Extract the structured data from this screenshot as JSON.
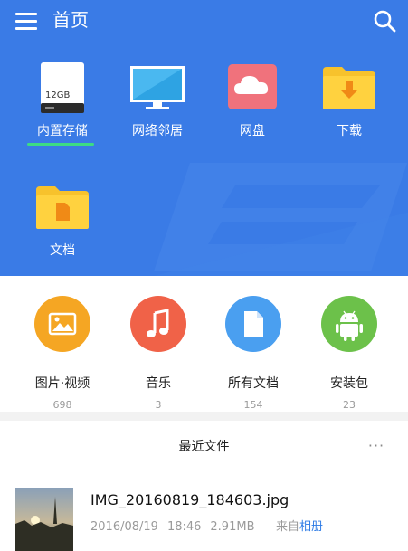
{
  "appbar": {
    "title": "首页",
    "menu_icon": "hamburger-menu-icon",
    "search_icon": "search-icon"
  },
  "storage_tiles": [
    {
      "label": "内置存储",
      "icon": "storage-12gb-icon",
      "badge": "12GB",
      "selected": true
    },
    {
      "label": "网络邻居",
      "icon": "monitor-icon"
    },
    {
      "label": "网盘",
      "icon": "cloud-icon"
    },
    {
      "label": "下载",
      "icon": "download-folder-icon"
    },
    {
      "label": "文档",
      "icon": "document-folder-icon"
    }
  ],
  "categories": [
    {
      "label": "图片·视频",
      "count": "698",
      "icon": "image-icon",
      "color": "#f5a623"
    },
    {
      "label": "音乐",
      "count": "3",
      "icon": "music-note-icon",
      "color": "#f06248"
    },
    {
      "label": "所有文档",
      "count": "154",
      "icon": "document-icon",
      "color": "#4a9ff0"
    },
    {
      "label": "安装包",
      "count": "23",
      "icon": "android-icon",
      "color": "#6cc14a"
    }
  ],
  "recent": {
    "title": "最近文件",
    "more_icon": "more-dots-icon",
    "files": [
      {
        "name": "IMG_20160819_184603.jpg",
        "date": "2016/08/19",
        "time": "18:46",
        "size": "2.91MB",
        "source_prefix": "来自",
        "source": "相册"
      }
    ]
  },
  "colors": {
    "header_blue": "#3a7be6",
    "selected_underline": "#3ddc84",
    "link_blue": "#2d7be5"
  }
}
